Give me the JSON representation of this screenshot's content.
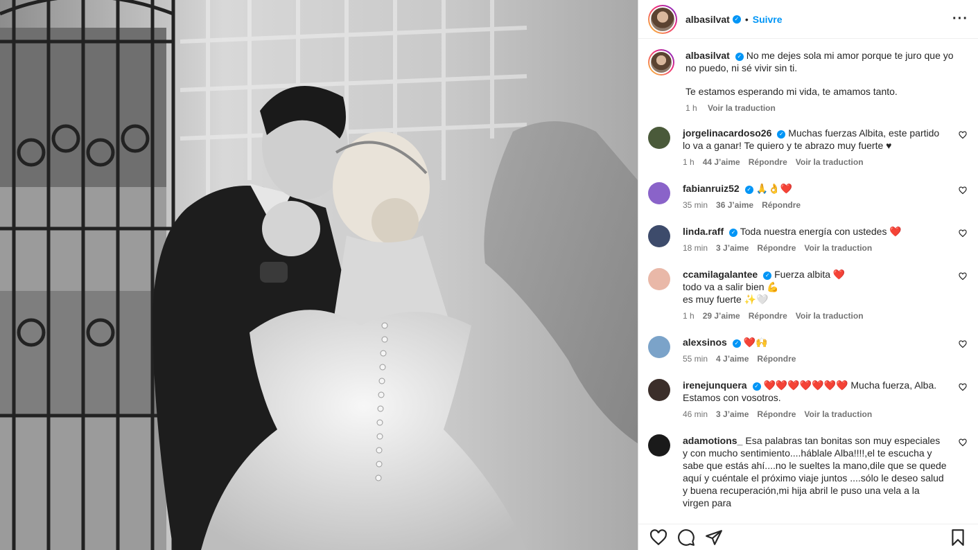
{
  "post_author": {
    "username": "albasilvat",
    "verified_icon": "verified-badge-icon",
    "dot": "•",
    "follow_label": "Suivre"
  },
  "caption": {
    "username": "albasilvat",
    "line1": "No me dejes sola mi amor porque te juro que yo no puedo, ni sé vivir sin ti.",
    "line2": "Te estamos esperando mi vida, te amamos tanto.",
    "time": "1 h",
    "translate": "Voir la traduction"
  },
  "comments": [
    {
      "username": "jorgelinacardoso26",
      "verified": true,
      "text": "Muchas fuerzas Albita, este partido lo va a ganar! Te quiero y te abrazo muy fuerte ♥",
      "time": "1 h",
      "likes": "44 J’aime",
      "reply": "Répondre",
      "translate": "Voir la traduction",
      "avatar_color": "#4a5a3a"
    },
    {
      "username": "fabianruiz52",
      "verified": true,
      "text": "🙏👌❤️",
      "time": "35 min",
      "likes": "36 J’aime",
      "reply": "Répondre",
      "translate": "",
      "avatar_color": "#8a63c9"
    },
    {
      "username": "linda.raff",
      "verified": true,
      "text": "Toda nuestra energía con ustedes ❤️",
      "time": "18 min",
      "likes": "3 J’aime",
      "reply": "Répondre",
      "translate": "Voir la traduction",
      "avatar_color": "#3d4b6b"
    },
    {
      "username": "ccamilagalantee",
      "verified": true,
      "text": "Fuerza albita ❤️\ntodo va a salir bien 💪\nes muy fuerte ✨🤍",
      "time": "1 h",
      "likes": "29 J’aime",
      "reply": "Répondre",
      "translate": "Voir la traduction",
      "avatar_color": "#e9b8a8"
    },
    {
      "username": "alexsinos",
      "verified": true,
      "text": "❤️🙌",
      "time": "55 min",
      "likes": "4 J’aime",
      "reply": "Répondre",
      "translate": "",
      "avatar_color": "#7ba3c9"
    },
    {
      "username": "irenejunquera",
      "verified": true,
      "text": "❤️❤️❤️❤️❤️❤️❤️ Mucha fuerza, Alba. Estamos con vosotros.",
      "time": "46 min",
      "likes": "3 J’aime",
      "reply": "Répondre",
      "translate": "Voir la traduction",
      "avatar_color": "#3b2e2a"
    },
    {
      "username": "adamotions_",
      "verified": false,
      "text": "Esa palabras tan bonitas son muy especiales y con mucho sentimiento....háblale Alba!!!!,el te escucha y sabe que estás ahí....no le sueltes la mano,dile que se quede aquí y cuéntale el próximo viaje juntos ....sólo le deseo salud y buena recuperación,mi hija abril le puso una vela a la virgen para",
      "time": "",
      "likes": "",
      "reply": "",
      "translate": "",
      "avatar_color": "#1a1a1a"
    }
  ],
  "footer": {
    "like_icon": "heart-outline-icon",
    "comment_icon": "comment-icon",
    "share_icon": "share-icon",
    "save_icon": "bookmark-icon"
  },
  "photo": {
    "description_icon": "wedding-photo",
    "tone": "black-and-white"
  }
}
